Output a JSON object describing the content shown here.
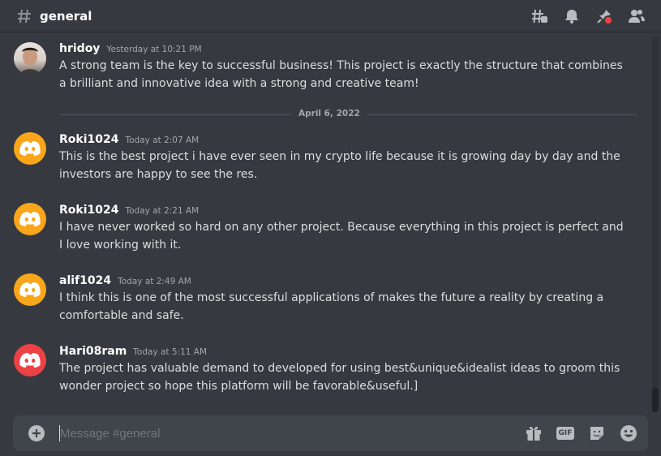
{
  "header": {
    "channel_name": "general"
  },
  "icons": {
    "header": [
      "threads-icon",
      "bell-icon",
      "pin-icon",
      "members-icon"
    ],
    "composer": [
      "plus-circle-icon",
      "gift-icon",
      "gif-icon",
      "sticker-icon",
      "emoji-icon"
    ]
  },
  "colors": {
    "background": "#36393f",
    "accent_orange": "#faa61a",
    "accent_red": "#ed4245",
    "composer_bg": "#40444b"
  },
  "divider": {
    "date": "April 6, 2022"
  },
  "messages": [
    {
      "author": "hridoy",
      "timestamp": "Yesterday at 10:21 PM",
      "text": "A strong team is the key to successful business! This project is exactly the structure that combines a brilliant and innovative idea with a strong and creative team!",
      "avatar": "photo"
    },
    {
      "author": "Roki1024",
      "timestamp": "Today at 2:07 AM",
      "text": "This is the best project i have ever seen in my crypto life because it is growing day by day and the investors are happy to see the res.",
      "avatar": "discord-orange"
    },
    {
      "author": "Roki1024",
      "timestamp": "Today at 2:21 AM",
      "text": "I have never worked so hard on any other project. Because everything in this project is perfect and I love working with it.",
      "avatar": "discord-orange"
    },
    {
      "author": "alif1024",
      "timestamp": "Today at 2:49 AM",
      "text": "I think this is one of the most successful applications of makes the future a reality by creating a comfortable and safe.",
      "avatar": "discord-orange"
    },
    {
      "author": "Hari08ram",
      "timestamp": "Today at 5:11 AM",
      "text": "The project has valuable demand to developed for using best&unique&idealist ideas to groom this wonder project so hope this platform will be favorable&useful.]",
      "avatar": "discord-red"
    }
  ],
  "composer": {
    "placeholder": "Message #general",
    "value": "",
    "gif_label": "GIF"
  }
}
